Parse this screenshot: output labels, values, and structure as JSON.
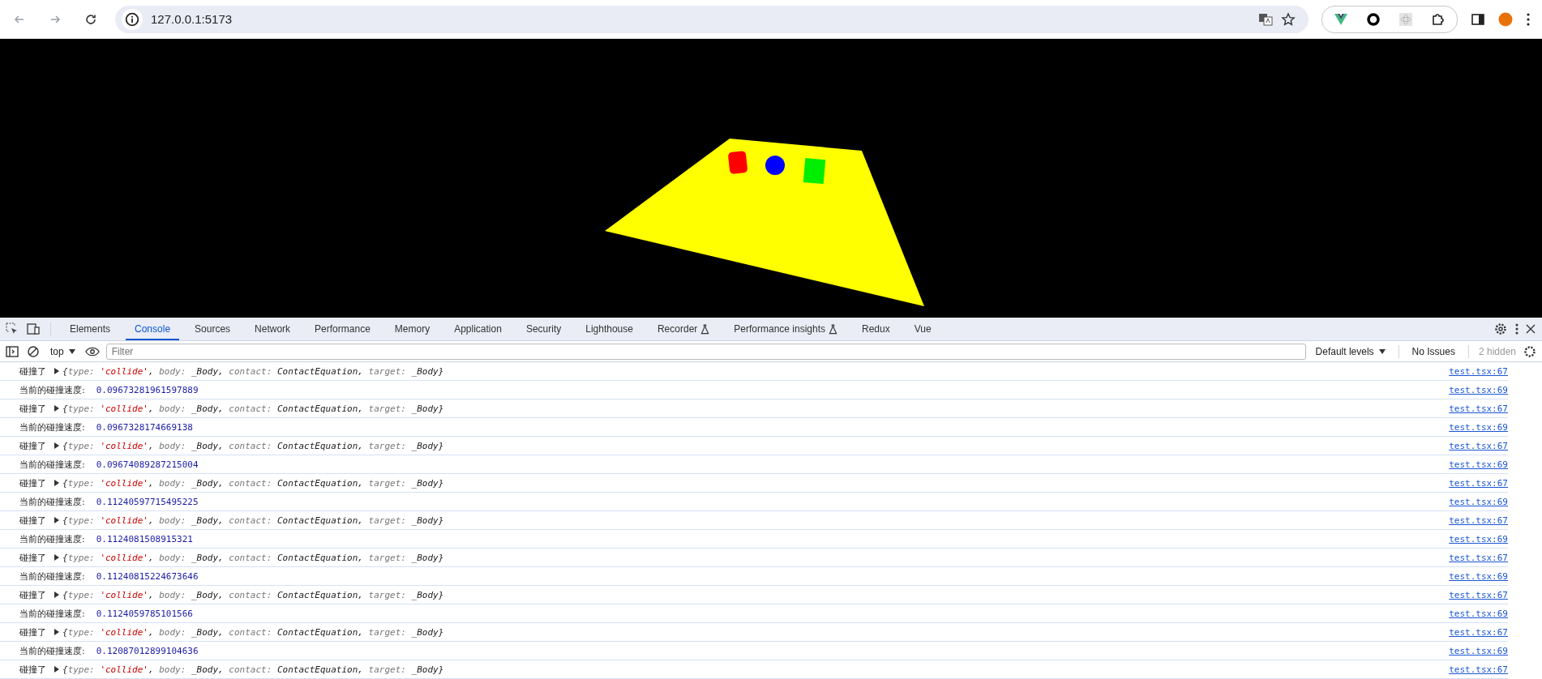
{
  "browser": {
    "url": "127.0.0.1:5173"
  },
  "devtools": {
    "tabs": [
      {
        "label": "Elements",
        "selected": false,
        "experimental": false
      },
      {
        "label": "Console",
        "selected": true,
        "experimental": false
      },
      {
        "label": "Sources",
        "selected": false,
        "experimental": false
      },
      {
        "label": "Network",
        "selected": false,
        "experimental": false
      },
      {
        "label": "Performance",
        "selected": false,
        "experimental": false
      },
      {
        "label": "Memory",
        "selected": false,
        "experimental": false
      },
      {
        "label": "Application",
        "selected": false,
        "experimental": false
      },
      {
        "label": "Security",
        "selected": false,
        "experimental": false
      },
      {
        "label": "Lighthouse",
        "selected": false,
        "experimental": false
      },
      {
        "label": "Recorder",
        "selected": false,
        "experimental": true
      },
      {
        "label": "Performance insights",
        "selected": false,
        "experimental": true
      },
      {
        "label": "Redux",
        "selected": false,
        "experimental": false
      },
      {
        "label": "Vue",
        "selected": false,
        "experimental": false
      }
    ],
    "toolbar": {
      "context": "top",
      "filter_placeholder": "Filter",
      "levels": "Default levels",
      "issues": "No Issues",
      "hidden": "2 hidden"
    }
  },
  "console": {
    "rows": [
      {
        "kind": "object",
        "label": "碰撞了",
        "parts": [
          {
            "text": "{",
            "kind": "punct"
          },
          {
            "text": "type: ",
            "kind": "key"
          },
          {
            "text": "'collide'",
            "kind": "string"
          },
          {
            "text": ", ",
            "kind": "punct"
          },
          {
            "text": "body: ",
            "kind": "key"
          },
          {
            "text": "_Body",
            "kind": "ref"
          },
          {
            "text": ", ",
            "kind": "punct"
          },
          {
            "text": "contact: ",
            "kind": "key"
          },
          {
            "text": "ContactEquation",
            "kind": "ref"
          },
          {
            "text": ", ",
            "kind": "punct"
          },
          {
            "text": "target: ",
            "kind": "key"
          },
          {
            "text": "_Body",
            "kind": "ref"
          },
          {
            "text": "}",
            "kind": "punct"
          }
        ],
        "source": "test.tsx:67"
      },
      {
        "kind": "number",
        "label": "当前的碰撞速度:",
        "value": "0.09673281961597889",
        "source": "test.tsx:69"
      },
      {
        "kind": "object",
        "label": "碰撞了",
        "parts": [
          {
            "text": "{",
            "kind": "punct"
          },
          {
            "text": "type: ",
            "kind": "key"
          },
          {
            "text": "'collide'",
            "kind": "string"
          },
          {
            "text": ", ",
            "kind": "punct"
          },
          {
            "text": "body: ",
            "kind": "key"
          },
          {
            "text": "_Body",
            "kind": "ref"
          },
          {
            "text": ", ",
            "kind": "punct"
          },
          {
            "text": "contact: ",
            "kind": "key"
          },
          {
            "text": "ContactEquation",
            "kind": "ref"
          },
          {
            "text": ", ",
            "kind": "punct"
          },
          {
            "text": "target: ",
            "kind": "key"
          },
          {
            "text": "_Body",
            "kind": "ref"
          },
          {
            "text": "}",
            "kind": "punct"
          }
        ],
        "source": "test.tsx:67"
      },
      {
        "kind": "number",
        "label": "当前的碰撞速度:",
        "value": "0.0967328174669138",
        "source": "test.tsx:69"
      },
      {
        "kind": "object",
        "label": "碰撞了",
        "parts": [
          {
            "text": "{",
            "kind": "punct"
          },
          {
            "text": "type: ",
            "kind": "key"
          },
          {
            "text": "'collide'",
            "kind": "string"
          },
          {
            "text": ", ",
            "kind": "punct"
          },
          {
            "text": "body: ",
            "kind": "key"
          },
          {
            "text": "_Body",
            "kind": "ref"
          },
          {
            "text": ", ",
            "kind": "punct"
          },
          {
            "text": "contact: ",
            "kind": "key"
          },
          {
            "text": "ContactEquation",
            "kind": "ref"
          },
          {
            "text": ", ",
            "kind": "punct"
          },
          {
            "text": "target: ",
            "kind": "key"
          },
          {
            "text": "_Body",
            "kind": "ref"
          },
          {
            "text": "}",
            "kind": "punct"
          }
        ],
        "source": "test.tsx:67"
      },
      {
        "kind": "number",
        "label": "当前的碰撞速度:",
        "value": "0.09674089287215004",
        "source": "test.tsx:69"
      },
      {
        "kind": "object",
        "label": "碰撞了",
        "parts": [
          {
            "text": "{",
            "kind": "punct"
          },
          {
            "text": "type: ",
            "kind": "key"
          },
          {
            "text": "'collide'",
            "kind": "string"
          },
          {
            "text": ", ",
            "kind": "punct"
          },
          {
            "text": "body: ",
            "kind": "key"
          },
          {
            "text": "_Body",
            "kind": "ref"
          },
          {
            "text": ", ",
            "kind": "punct"
          },
          {
            "text": "contact: ",
            "kind": "key"
          },
          {
            "text": "ContactEquation",
            "kind": "ref"
          },
          {
            "text": ", ",
            "kind": "punct"
          },
          {
            "text": "target: ",
            "kind": "key"
          },
          {
            "text": "_Body",
            "kind": "ref"
          },
          {
            "text": "}",
            "kind": "punct"
          }
        ],
        "source": "test.tsx:67"
      },
      {
        "kind": "number",
        "label": "当前的碰撞速度:",
        "value": "0.11240597715495225",
        "source": "test.tsx:69"
      },
      {
        "kind": "object",
        "label": "碰撞了",
        "parts": [
          {
            "text": "{",
            "kind": "punct"
          },
          {
            "text": "type: ",
            "kind": "key"
          },
          {
            "text": "'collide'",
            "kind": "string"
          },
          {
            "text": ", ",
            "kind": "punct"
          },
          {
            "text": "body: ",
            "kind": "key"
          },
          {
            "text": "_Body",
            "kind": "ref"
          },
          {
            "text": ", ",
            "kind": "punct"
          },
          {
            "text": "contact: ",
            "kind": "key"
          },
          {
            "text": "ContactEquation",
            "kind": "ref"
          },
          {
            "text": ", ",
            "kind": "punct"
          },
          {
            "text": "target: ",
            "kind": "key"
          },
          {
            "text": "_Body",
            "kind": "ref"
          },
          {
            "text": "}",
            "kind": "punct"
          }
        ],
        "source": "test.tsx:67"
      },
      {
        "kind": "number",
        "label": "当前的碰撞速度:",
        "value": "0.1124081508915321",
        "source": "test.tsx:69"
      },
      {
        "kind": "object",
        "label": "碰撞了",
        "parts": [
          {
            "text": "{",
            "kind": "punct"
          },
          {
            "text": "type: ",
            "kind": "key"
          },
          {
            "text": "'collide'",
            "kind": "string"
          },
          {
            "text": ", ",
            "kind": "punct"
          },
          {
            "text": "body: ",
            "kind": "key"
          },
          {
            "text": "_Body",
            "kind": "ref"
          },
          {
            "text": ", ",
            "kind": "punct"
          },
          {
            "text": "contact: ",
            "kind": "key"
          },
          {
            "text": "ContactEquation",
            "kind": "ref"
          },
          {
            "text": ", ",
            "kind": "punct"
          },
          {
            "text": "target: ",
            "kind": "key"
          },
          {
            "text": "_Body",
            "kind": "ref"
          },
          {
            "text": "}",
            "kind": "punct"
          }
        ],
        "source": "test.tsx:67"
      },
      {
        "kind": "number",
        "label": "当前的碰撞速度:",
        "value": "0.11240815224673646",
        "source": "test.tsx:69"
      },
      {
        "kind": "object",
        "label": "碰撞了",
        "parts": [
          {
            "text": "{",
            "kind": "punct"
          },
          {
            "text": "type: ",
            "kind": "key"
          },
          {
            "text": "'collide'",
            "kind": "string"
          },
          {
            "text": ", ",
            "kind": "punct"
          },
          {
            "text": "body: ",
            "kind": "key"
          },
          {
            "text": "_Body",
            "kind": "ref"
          },
          {
            "text": ", ",
            "kind": "punct"
          },
          {
            "text": "contact: ",
            "kind": "key"
          },
          {
            "text": "ContactEquation",
            "kind": "ref"
          },
          {
            "text": ", ",
            "kind": "punct"
          },
          {
            "text": "target: ",
            "kind": "key"
          },
          {
            "text": "_Body",
            "kind": "ref"
          },
          {
            "text": "}",
            "kind": "punct"
          }
        ],
        "source": "test.tsx:67"
      },
      {
        "kind": "number",
        "label": "当前的碰撞速度:",
        "value": "0.1124059785101566",
        "source": "test.tsx:69"
      },
      {
        "kind": "object",
        "label": "碰撞了",
        "parts": [
          {
            "text": "{",
            "kind": "punct"
          },
          {
            "text": "type: ",
            "kind": "key"
          },
          {
            "text": "'collide'",
            "kind": "string"
          },
          {
            "text": ", ",
            "kind": "punct"
          },
          {
            "text": "body: ",
            "kind": "key"
          },
          {
            "text": "_Body",
            "kind": "ref"
          },
          {
            "text": ", ",
            "kind": "punct"
          },
          {
            "text": "contact: ",
            "kind": "key"
          },
          {
            "text": "ContactEquation",
            "kind": "ref"
          },
          {
            "text": ", ",
            "kind": "punct"
          },
          {
            "text": "target: ",
            "kind": "key"
          },
          {
            "text": "_Body",
            "kind": "ref"
          },
          {
            "text": "}",
            "kind": "punct"
          }
        ],
        "source": "test.tsx:67"
      },
      {
        "kind": "number",
        "label": "当前的碰撞速度:",
        "value": "0.12087012899104636",
        "source": "test.tsx:69"
      },
      {
        "kind": "object",
        "label": "碰撞了",
        "parts": [
          {
            "text": "{",
            "kind": "punct"
          },
          {
            "text": "type: ",
            "kind": "key"
          },
          {
            "text": "'collide'",
            "kind": "string"
          },
          {
            "text": ", ",
            "kind": "punct"
          },
          {
            "text": "body: ",
            "kind": "key"
          },
          {
            "text": "_Body",
            "kind": "ref"
          },
          {
            "text": ", ",
            "kind": "punct"
          },
          {
            "text": "contact: ",
            "kind": "key"
          },
          {
            "text": "ContactEquation",
            "kind": "ref"
          },
          {
            "text": ", ",
            "kind": "punct"
          },
          {
            "text": "target: ",
            "kind": "key"
          },
          {
            "text": "_Body",
            "kind": "ref"
          },
          {
            "text": "}",
            "kind": "punct"
          }
        ],
        "source": "test.tsx:67"
      }
    ]
  }
}
